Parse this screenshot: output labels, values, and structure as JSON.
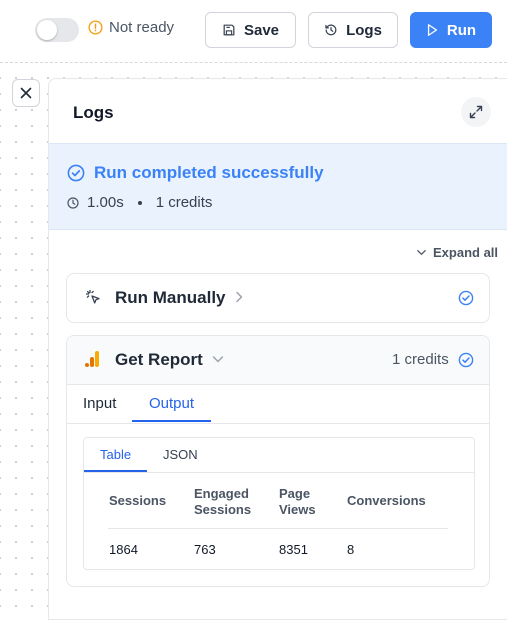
{
  "toolbar": {
    "status_label": "Not ready",
    "save_label": "Save",
    "logs_label": "Logs",
    "run_label": "Run"
  },
  "panel": {
    "title": "Logs",
    "banner": {
      "title": "Run completed successfully",
      "duration": "1.00s",
      "credits": "1 credits"
    },
    "expand_all_label": "Expand all",
    "steps": [
      {
        "name": "Run Manually"
      },
      {
        "name": "Get Report",
        "credits": "1 credits"
      }
    ],
    "tabs": [
      "Input",
      "Output"
    ],
    "active_tab": "Output",
    "output": {
      "subtabs": [
        "Table",
        "JSON"
      ],
      "active_subtab": "Table",
      "columns": [
        [
          "Sessions"
        ],
        [
          "Engaged",
          "Sessions"
        ],
        [
          "Page",
          "Views"
        ],
        [
          "Conversions"
        ]
      ],
      "rows": [
        [
          "1864",
          "763",
          "8351",
          "8"
        ]
      ]
    }
  },
  "colors": {
    "accent": "#3b82f6",
    "banner_bg": "#eaf2fe",
    "warning": "#f59e0b",
    "analytics_orange": "#f9ab00"
  }
}
